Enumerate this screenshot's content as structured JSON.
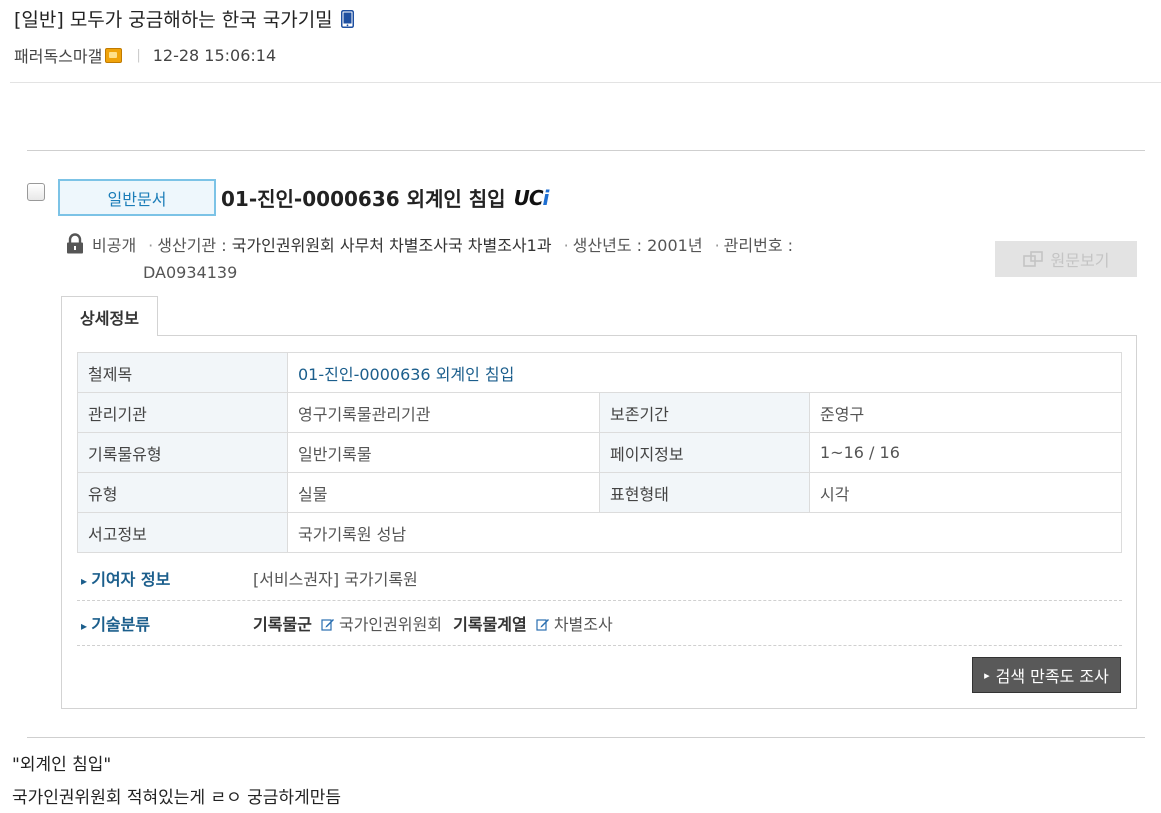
{
  "post": {
    "title": "[일반] 모두가 궁금해하는 한국 국가기밀",
    "author": "패러독스마갤",
    "datetime": "12-28 15:06:14",
    "separator": "|",
    "body_lines": [
      "\"외계인 침입\"",
      "국가인권위원회 적혀있는게 ㄹㅇ 궁금하게만듬"
    ]
  },
  "record": {
    "doc_type": "일반문서",
    "title": "01-진인-0000636 외계인 침입",
    "logo": {
      "u": "U",
      "c": "C",
      "i": "i"
    },
    "access": "비공개",
    "producer_label": "생산기관 :",
    "producer": "국가인권위원회 사무처 차별조사국 차별조사1과",
    "year_label": "생산년도 :",
    "year": "2001년",
    "mgmt_label": "관리번호 :",
    "mgmt_no": "DA0934139",
    "view_button": "원문보기",
    "tab": "상세정보",
    "details": {
      "file_title_label": "철제목",
      "file_title": "01-진인-0000636 외계인 침입",
      "agency_label": "관리기관",
      "agency": "영구기록물관리기관",
      "retention_label": "보존기간",
      "retention": "준영구",
      "record_type_label": "기록물유형",
      "record_type": "일반기록물",
      "page_info_label": "페이지정보",
      "page_info": "1~16 / 16",
      "form_label": "유형",
      "form": "실물",
      "expression_label": "표현형태",
      "expression": "시각",
      "location_label": "서고정보",
      "location": "국가기록원 성남"
    },
    "contributor_label": "기여자 정보",
    "contributor": "[서비스권자] 국가기록원",
    "classification_label": "기술분류",
    "class_group_label": "기록물군",
    "class_group": "국가인권위원회",
    "class_series_label": "기록물계열",
    "class_series": "차별조사",
    "survey_button": "검색 만족도 조사"
  },
  "colors": {
    "accent_blue": "#1b7db8",
    "link": "#1b5e8c",
    "dark_button": "#595959"
  },
  "icons": [
    "mobile-icon",
    "level-badge-icon",
    "lock-icon",
    "frame-icon",
    "pen-icon"
  ]
}
